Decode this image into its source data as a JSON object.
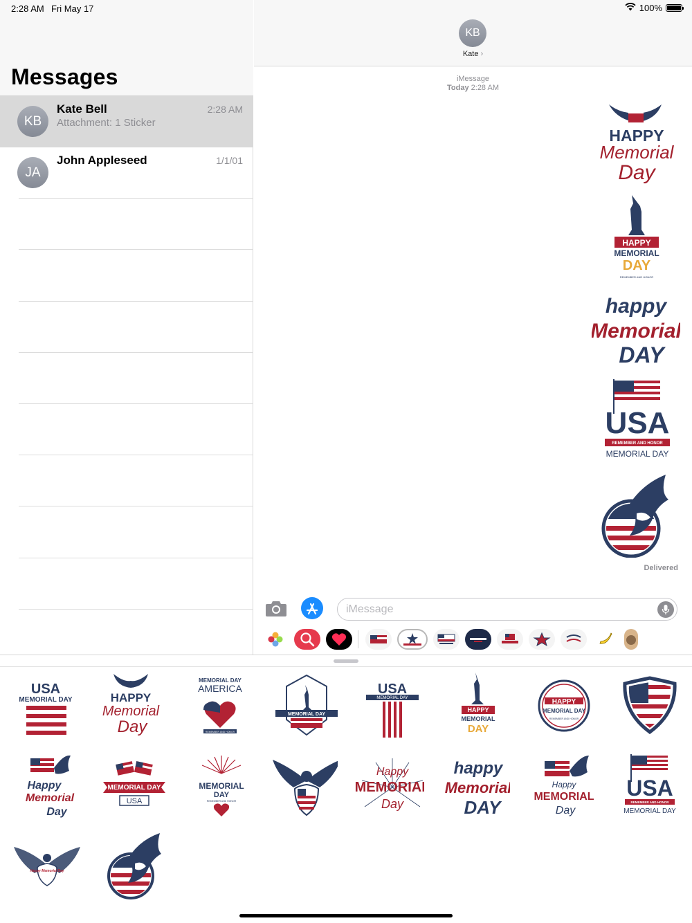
{
  "status_bar": {
    "time": "2:28 AM",
    "date": "Fri May 17",
    "battery_percent": "100%",
    "wifi": "wifi-icon",
    "battery_level": 1.0
  },
  "sidebar": {
    "title": "Messages",
    "conversations": [
      {
        "initials": "KB",
        "name": "Kate Bell",
        "preview": "Attachment: 1 Sticker",
        "date": "2:28 AM",
        "selected": true
      },
      {
        "initials": "JA",
        "name": "John Appleseed",
        "preview": "",
        "date": "1/1/01",
        "selected": false
      }
    ]
  },
  "chat": {
    "contact_initials": "KB",
    "contact_name": "Kate",
    "service": "iMessage",
    "timestamp_day": "Today",
    "timestamp_time": "2:28 AM",
    "delivered": "Delivered",
    "stickers": [
      {
        "icon": "eagle-happy-memorial-day-sticker",
        "line1": "HAPPY",
        "line2": "Memorial",
        "line3": "Day"
      },
      {
        "icon": "statue-of-liberty-happy-memorial-day-sticker",
        "line1": "HAPPY",
        "line2": "MEMORIAL",
        "line3": "DAY",
        "line4": "REMEMBER AND HONOR"
      },
      {
        "icon": "happy-memorial-day-script-sticker",
        "line1": "happy",
        "line2": "Memorial",
        "line3": "DAY"
      },
      {
        "icon": "usa-flag-memorial-day-sticker",
        "line1": "USA",
        "line2": "REMEMBER AND HONOR",
        "line3": "MEMORIAL DAY"
      },
      {
        "icon": "eagle-flag-circle-sticker"
      }
    ]
  },
  "compose": {
    "placeholder": "iMessage",
    "camera_icon": "camera-icon",
    "appstore_icon": "app-store-icon",
    "mic_icon": "microphone-icon"
  },
  "app_strip": [
    {
      "icon": "photos-app-icon"
    },
    {
      "icon": "image-search-app-icon"
    },
    {
      "icon": "digital-touch-heart-icon"
    },
    {
      "icon": "memorial-day-sticker-app-1-icon"
    },
    {
      "icon": "memorial-day-sticker-app-2-icon",
      "selected": true
    },
    {
      "icon": "memorial-day-sticker-app-3-icon"
    },
    {
      "icon": "memorial-day-sticker-app-4-icon"
    },
    {
      "icon": "memorial-day-sticker-app-5-icon"
    },
    {
      "icon": "memorial-day-sticker-app-6-icon"
    },
    {
      "icon": "memorial-day-sticker-app-7-icon"
    },
    {
      "icon": "banana-app-icon"
    },
    {
      "icon": "cat-app-icon"
    }
  ],
  "drawer_stickers": [
    {
      "icon": "usa-flag-sticker",
      "lines": [
        "USA",
        "MEMORIAL DAY"
      ]
    },
    {
      "icon": "eagle-happy-memorial-day-sticker",
      "lines": [
        "HAPPY",
        "Memorial",
        "Day"
      ]
    },
    {
      "icon": "heart-flag-america-sticker",
      "lines": [
        "MEMORIAL DAY",
        "AMERICA",
        "REMEMBER AND HONOR"
      ]
    },
    {
      "icon": "liberty-hexagon-sticker",
      "lines": [
        "MEMORIAL DAY"
      ]
    },
    {
      "icon": "usa-banner-flag-sticker",
      "lines": [
        "USA",
        "MEMORIAL DAY"
      ]
    },
    {
      "icon": "statue-of-liberty-sticker",
      "lines": [
        "HAPPY",
        "MEMORIAL",
        "DAY"
      ]
    },
    {
      "icon": "circle-badge-sticker",
      "lines": [
        "HAPPY",
        "MEMORIAL DAY",
        "REMEMBER AND HONOR"
      ]
    },
    {
      "icon": "flag-shield-sticker",
      "lines": []
    },
    {
      "icon": "eagle-flag-script-sticker",
      "lines": [
        "Happy",
        "Memorial",
        "Day"
      ]
    },
    {
      "icon": "crossed-flags-ribbon-sticker",
      "lines": [
        "MEMORIAL DAY",
        "USA"
      ]
    },
    {
      "icon": "sunburst-memorial-day-sticker",
      "lines": [
        "MEMORIAL",
        "DAY",
        "REMEMBER AND HONOR"
      ]
    },
    {
      "icon": "eagle-shield-sticker",
      "lines": []
    },
    {
      "icon": "happy-memorial-day-burst-sticker",
      "lines": [
        "Happy",
        "MEMORIAL",
        "Day"
      ]
    },
    {
      "icon": "happy-memorial-day-script-sticker",
      "lines": [
        "happy",
        "Memorial",
        "DAY"
      ]
    },
    {
      "icon": "eagle-flag-happy-memorial-sticker",
      "lines": [
        "Happy",
        "MEMORIAL",
        "Day"
      ]
    },
    {
      "icon": "usa-flag-pole-sticker",
      "lines": [
        "USA",
        "REMEMBER AND HONOR",
        "MEMORIAL DAY"
      ]
    },
    {
      "icon": "eagle-wings-sticker",
      "lines": [
        "Happy Memorial Day"
      ]
    },
    {
      "icon": "eagle-flag-circle-sticker",
      "lines": []
    }
  ],
  "colors": {
    "red": "#b22234",
    "navy": "#2c3e63",
    "gold": "#e8a93a",
    "gray": "#8e8e93",
    "blue": "#1a8cff"
  }
}
